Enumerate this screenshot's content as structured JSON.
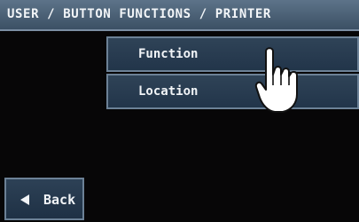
{
  "header": {
    "breadcrumb": "USER / BUTTON FUNCTIONS / PRINTER"
  },
  "menu": {
    "items": [
      {
        "label": "Function"
      },
      {
        "label": "Location"
      }
    ]
  },
  "footer": {
    "back_label": "Back"
  },
  "icons": {
    "back": "left-triangle-icon",
    "pointer": "pointing-hand-icon"
  },
  "colors": {
    "titlebar": "#4d6278",
    "button": "#2a3d52",
    "button_border": "#6c8196",
    "background": "#070607",
    "text": "#f1f4f7"
  }
}
